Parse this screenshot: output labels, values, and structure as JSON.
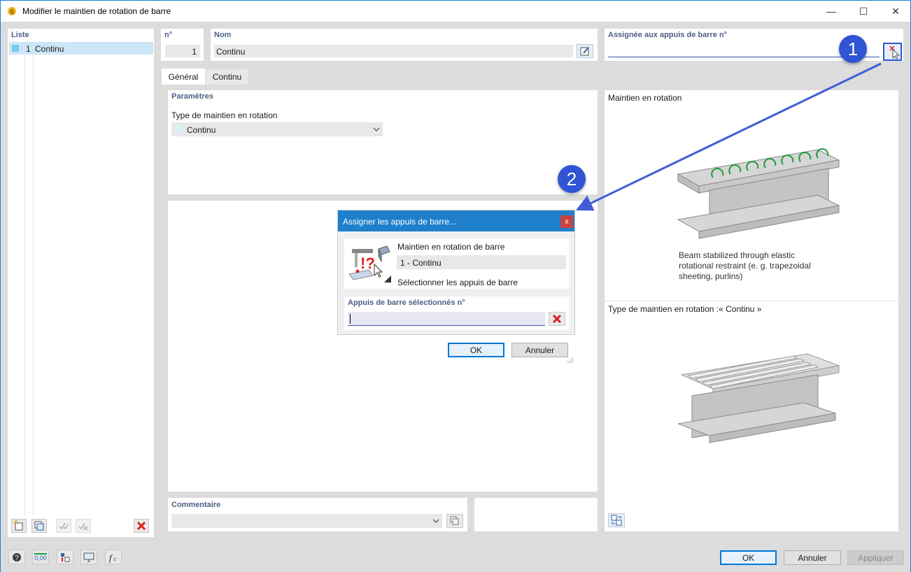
{
  "window": {
    "title": "Modifier le maintien de rotation de barre",
    "accent": "#1883d7"
  },
  "list": {
    "header": "Liste",
    "items": [
      {
        "num": "1",
        "name": "Continu"
      }
    ]
  },
  "fields": {
    "no_label": "n°",
    "no_value": "1",
    "name_label": "Nom",
    "name_value": "Continu",
    "assigned_label": "Assignée aux appuis de barre n°",
    "assigned_value": ""
  },
  "tabs": [
    {
      "label": "Général"
    },
    {
      "label": "Continu"
    }
  ],
  "params": {
    "section_title": "Paramètres",
    "type_label": "Type de maintien en rotation",
    "type_value": "Continu"
  },
  "preview": {
    "title1": "Maintien en rotation",
    "caption1": "Beam stabilized through elastic\nrotational restraint (e. g. trapezoidal\nsheeting, purlins)",
    "title2": "Type de maintien en rotation :« Continu »"
  },
  "comment": {
    "label": "Commentaire",
    "value": ""
  },
  "dialog": {
    "title": "Assigner les appuis de barre...",
    "close": "x",
    "item_label": "Maintien en rotation de barre",
    "item_value": "1 - Continu",
    "select_label": "Sélectionner les appuis de barre",
    "selected_label": "Appuis de barre sélectionnés n°",
    "selected_value": "",
    "ok": "OK",
    "cancel": "Annuler",
    "title_color": "#1e7fcb"
  },
  "footer": {
    "ok": "OK",
    "cancel": "Annuler",
    "apply": "Appliquer",
    "units_icon_text": "0,00"
  },
  "annotations": {
    "badge1": "1",
    "badge2": "2",
    "color": "#2f55d4"
  }
}
